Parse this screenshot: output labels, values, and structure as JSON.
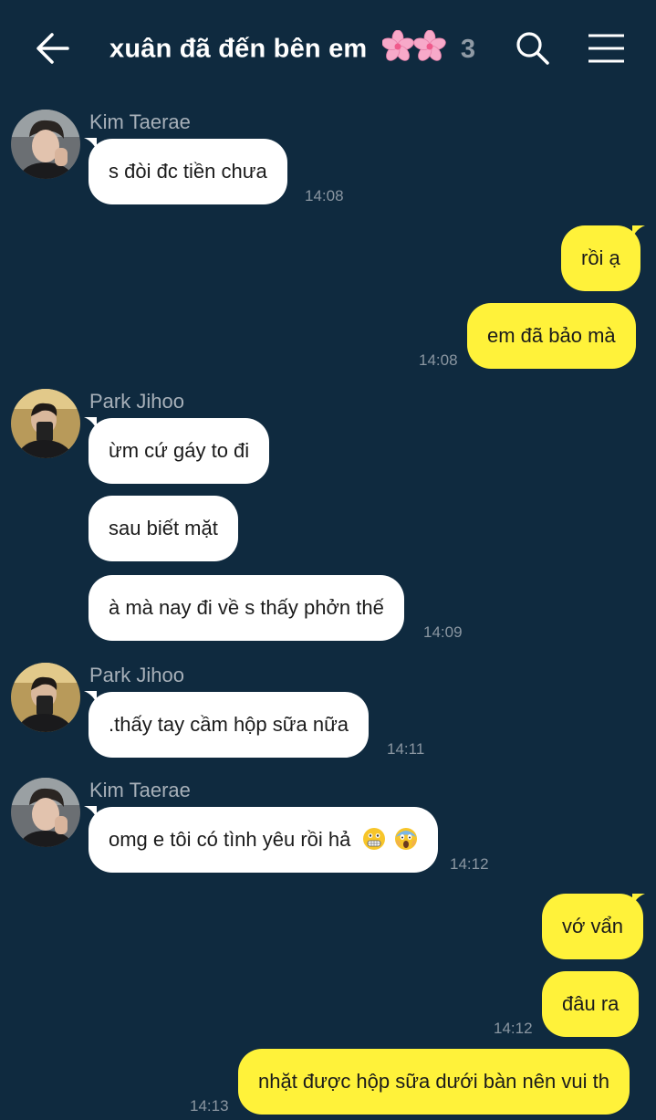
{
  "header": {
    "title": "xuân đã đến bên em",
    "member_count": "3"
  },
  "messages": [
    {
      "sender": "Kim Taerae",
      "text": "s đòi đc tiền chưa",
      "time": "14:08"
    },
    {
      "text": "rồi ạ"
    },
    {
      "text": "em đã bảo mà",
      "time": "14:08"
    },
    {
      "sender": "Park Jihoo",
      "text": "ừm cứ gáy to đi"
    },
    {
      "text": "sau biết mặt"
    },
    {
      "text": "à mà nay đi về s thấy phởn thế",
      "time": "14:09"
    },
    {
      "sender": "Park Jihoo",
      "text": ".thấy tay cầm hộp sữa nữa",
      "time": "14:11"
    },
    {
      "sender": "Kim Taerae",
      "text": "omg e tôi có tình yêu rồi hả",
      "time": "14:12"
    },
    {
      "text": "vớ vẩn"
    },
    {
      "text": "đâu ra",
      "time": "14:12"
    },
    {
      "text": "nhặt được hộp sữa dưới bàn nên vui th",
      "time": "14:13"
    }
  ],
  "colors": {
    "background": "#0f2a3f",
    "incoming_bubble": "#ffffff",
    "outgoing_bubble": "#fff23a",
    "sender_name": "#a7b0b9",
    "timestamp": "#8a96a1"
  },
  "icons": [
    "back-arrow-icon",
    "search-icon",
    "hamburger-menu-icon",
    "cherry-blossom-icon",
    "grimacing-face-emoji",
    "screaming-face-emoji"
  ]
}
